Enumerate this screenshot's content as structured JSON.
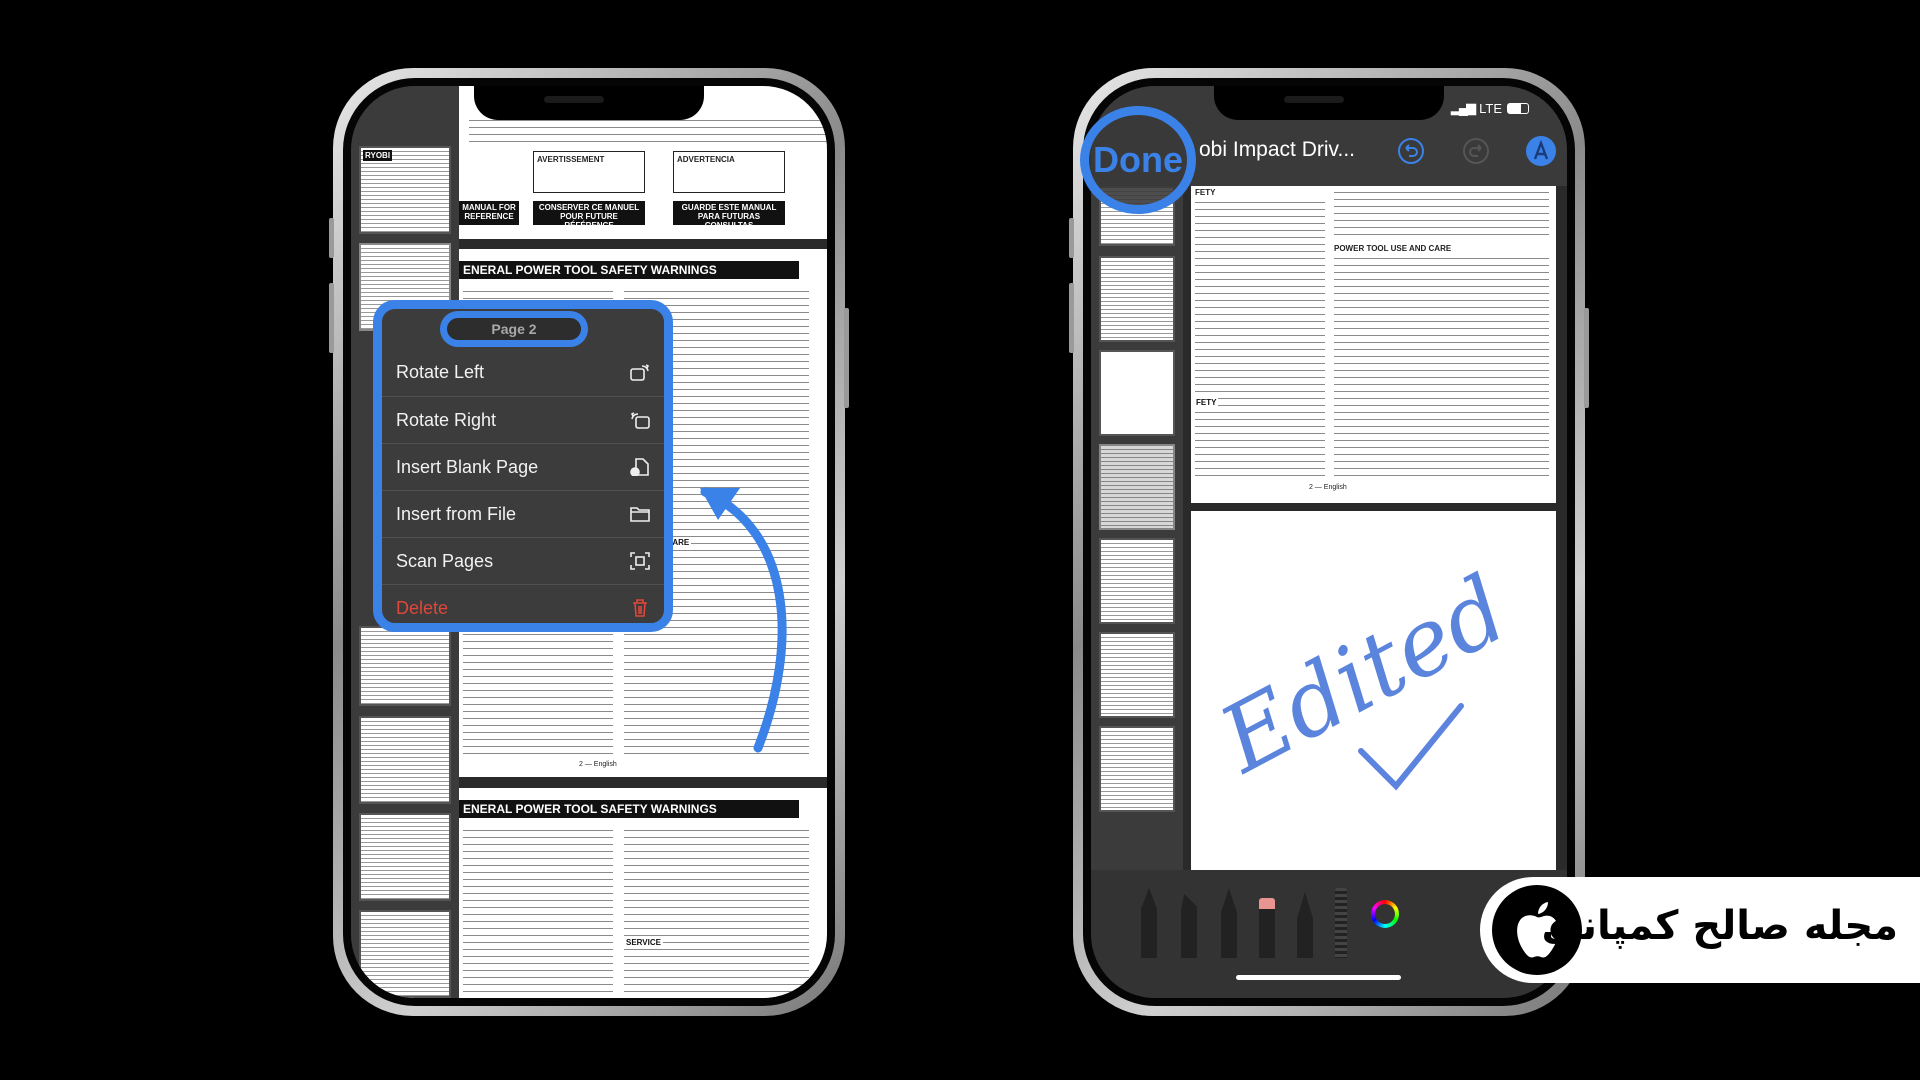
{
  "left_phone": {
    "doc": {
      "cover_texts": [
        "AVERTISSEMENT",
        "ADVERTENCIA"
      ],
      "cover_blocks": [
        "MANUAL FOR REFERENCE",
        "CONSERVER CE MANUEL POUR FUTURE RÉFÉRENCE",
        "GUARDE ESTE MANUAL PARA FUTURAS CONSULTAS"
      ],
      "heading1": "ENERAL POWER TOOL SAFETY WARNINGS",
      "heading2": "ENERAL POWER TOOL SAFETY WARNINGS",
      "subheading": "AND CARE",
      "footer": "2 — English",
      "service": "SERVICE",
      "brand": "RYOBI"
    },
    "context_menu": {
      "title": "Page 2",
      "items": [
        {
          "label": "Rotate Left",
          "icon": "rotate-left-icon"
        },
        {
          "label": "Rotate Right",
          "icon": "rotate-right-icon"
        },
        {
          "label": "Insert Blank Page",
          "icon": "insert-page-icon"
        },
        {
          "label": "Insert from File",
          "icon": "folder-icon"
        },
        {
          "label": "Scan Pages",
          "icon": "scan-icon"
        },
        {
          "label": "Delete",
          "icon": "trash-icon",
          "destructive": true
        }
      ]
    }
  },
  "right_phone": {
    "status": {
      "network": "LTE"
    },
    "header": {
      "done_label": "Done",
      "title": "obi Impact Driv..."
    },
    "doc": {
      "heading": "FETY",
      "subheading": "POWER TOOL USE AND CARE",
      "subheading2": "FETY",
      "footer": "2 — English",
      "annotation": "Edited"
    }
  },
  "watermark": {
    "text": "مجله صالح کمپانی"
  },
  "colors": {
    "highlight": "#3b82e8",
    "destructive": "#e0463a",
    "menu_bg": "#3c3c3c",
    "annotation": "#3f6fd8"
  }
}
